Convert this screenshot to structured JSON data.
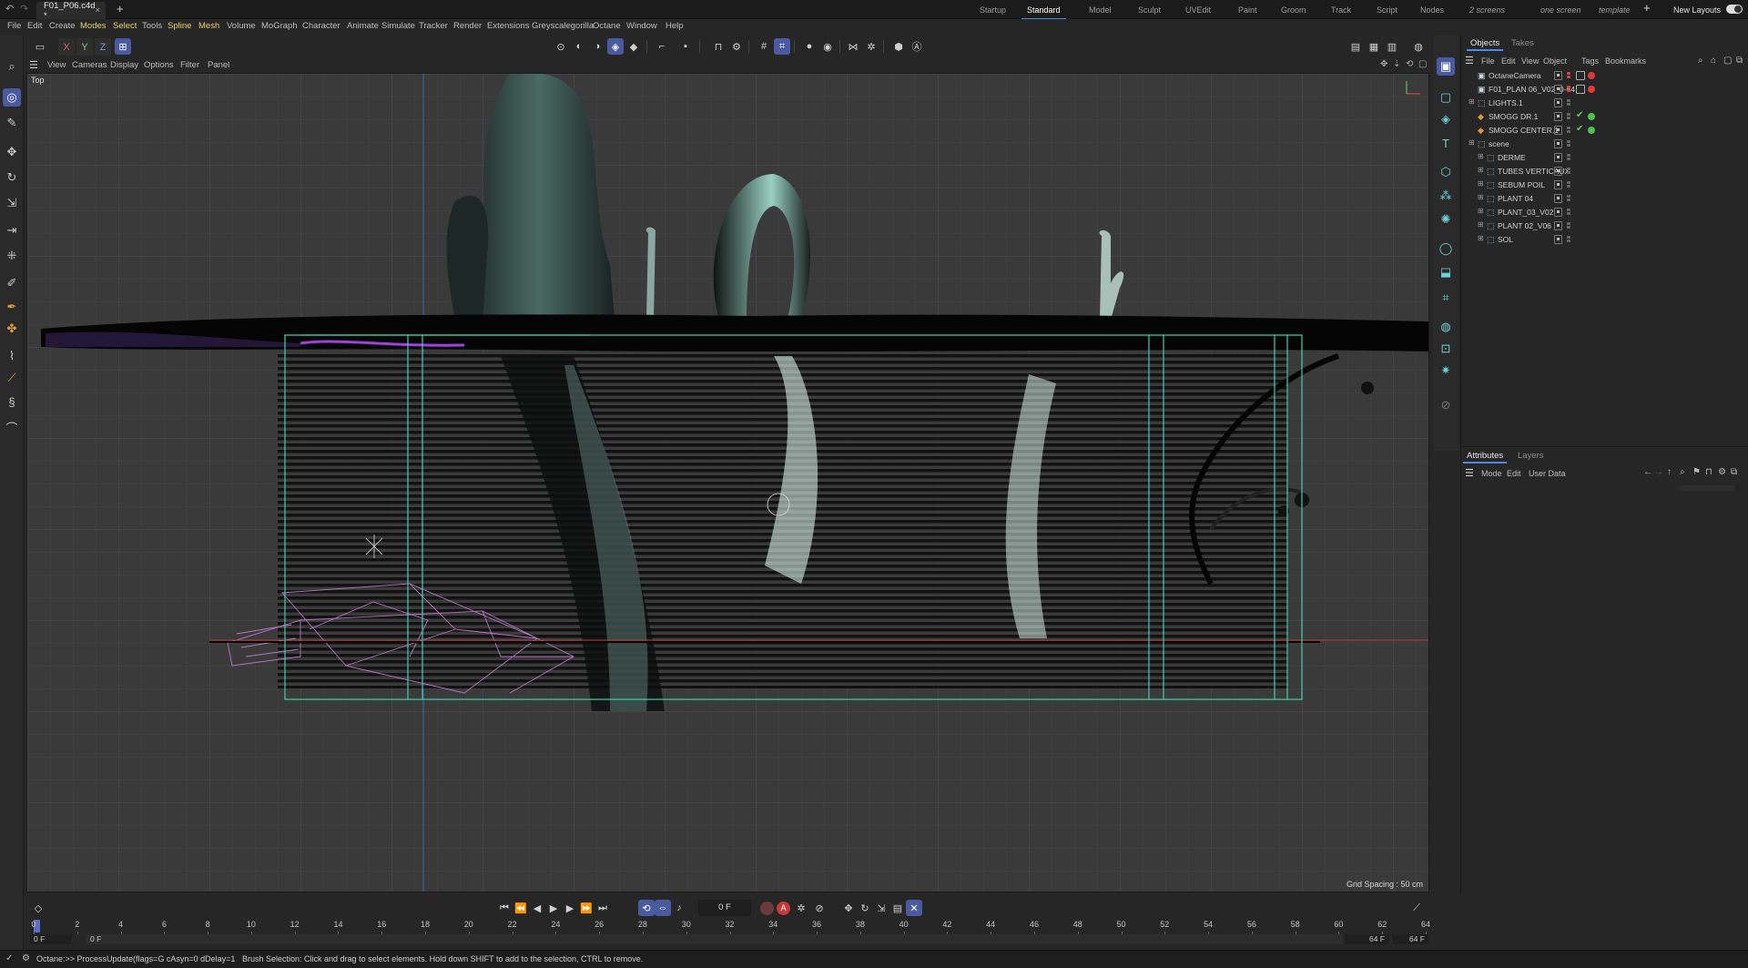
{
  "titlebar": {
    "doc_tab": "F01_P06.c4d *",
    "layouts": [
      "Startup",
      "Standard",
      "Model",
      "Sculpt",
      "UVEdit",
      "Paint",
      "Groom",
      "Track",
      "Script",
      "Nodes",
      "2 screens",
      "one screen",
      "template"
    ],
    "active_layout": "Standard",
    "new_layouts": "New Layouts"
  },
  "menubar": [
    "File",
    "Edit",
    "Create",
    "Modes",
    "Select",
    "Tools",
    "Spline",
    "Mesh",
    "Volume",
    "MoGraph",
    "Character",
    "Animate",
    "Simulate",
    "Tracker",
    "Render",
    "Extensions",
    "Greyscalegorilla",
    "Octane",
    "Window",
    "Help"
  ],
  "axis_buttons": [
    "X",
    "Y",
    "Z"
  ],
  "viewport_menu": [
    "View",
    "Cameras",
    "Display",
    "Options",
    "Filter",
    "Panel"
  ],
  "viewport": {
    "label": "Top",
    "grid_spacing": "Grid Spacing : 50 cm"
  },
  "objects_panel": {
    "tabs": [
      "Objects",
      "Takes"
    ],
    "active_tab": "Objects",
    "menu": [
      "File",
      "Edit",
      "View",
      "Object",
      "Tags",
      "Bookmarks"
    ],
    "rows": [
      {
        "name": "OctaneCamera",
        "level": 0,
        "icon": "camera-icon",
        "expand": false,
        "vis": "red",
        "tags": [
          "film",
          "dot-red"
        ]
      },
      {
        "name": "F01_PLAN 06_V02_0-64",
        "level": 0,
        "icon": "camera-icon",
        "expand": false,
        "vis": "red",
        "tags": [
          "film",
          "dot-red"
        ]
      },
      {
        "name": "LIGHTS.1",
        "level": 0,
        "icon": "null-icon",
        "expand": true,
        "vis": "grey",
        "tags": []
      },
      {
        "name": "SMOGG DR.1",
        "level": 0,
        "icon": "volume-icon",
        "expand": false,
        "vis": "grey",
        "tags": [
          "check",
          "dot-green"
        ]
      },
      {
        "name": "SMOGG CENTER.1",
        "level": 0,
        "icon": "volume-icon",
        "expand": false,
        "vis": "grey",
        "tags": [
          "check",
          "dot-green"
        ]
      },
      {
        "name": "scene",
        "level": 0,
        "icon": "null-icon",
        "expand": true,
        "vis": "grey",
        "tags": []
      },
      {
        "name": "DERME",
        "level": 1,
        "icon": "null-icon",
        "expand": true,
        "vis": "grey",
        "tags": []
      },
      {
        "name": "TUBES VERTICAUX",
        "level": 1,
        "icon": "null-icon",
        "expand": true,
        "vis": "grey",
        "tags": []
      },
      {
        "name": "SEBUM POIL",
        "level": 1,
        "icon": "null-icon",
        "expand": true,
        "vis": "grey",
        "tags": []
      },
      {
        "name": "PLANT 04",
        "level": 1,
        "icon": "null-icon",
        "expand": true,
        "vis": "grey",
        "tags": []
      },
      {
        "name": "PLANT_03_V02",
        "level": 1,
        "icon": "null-icon",
        "expand": true,
        "vis": "grey",
        "tags": []
      },
      {
        "name": "PLANT 02_V06",
        "level": 1,
        "icon": "null-icon",
        "expand": true,
        "vis": "grey",
        "tags": []
      },
      {
        "name": "SOL",
        "level": 1,
        "icon": "null-icon",
        "expand": true,
        "vis": "grey",
        "tags": []
      }
    ]
  },
  "attributes_panel": {
    "tabs": [
      "Attributes",
      "Layers"
    ],
    "active_tab": "Attributes",
    "menu": [
      "Mode",
      "Edit",
      "User Data"
    ]
  },
  "timeline": {
    "current_frame": "0 F",
    "ticks": [
      "0",
      "2",
      "4",
      "6",
      "8",
      "10",
      "12",
      "14",
      "16",
      "18",
      "20",
      "22",
      "24",
      "26",
      "28",
      "30",
      "32",
      "34",
      "36",
      "38",
      "40",
      "42",
      "44",
      "46",
      "48",
      "50",
      "52",
      "54",
      "56",
      "58",
      "60",
      "62",
      "64"
    ],
    "range_start_a": "0 F",
    "range_start_b": "0 F",
    "range_end_a": "64 F",
    "range_end_b": "64 F"
  },
  "statusbar": {
    "left": "Octane:>> ProcessUpdate(flags=G cAsyn=0 dDelay=1",
    "hint": "Brush Selection: Click and drag to select elements. Hold down SHIFT to add to the selection, CTRL to remove."
  },
  "colors": {
    "accent": "#4a5a9e",
    "highlight_menu": "#e8d06a",
    "frame_green": "#3fd1b0",
    "viewport_bg": "#3a3a3a"
  }
}
